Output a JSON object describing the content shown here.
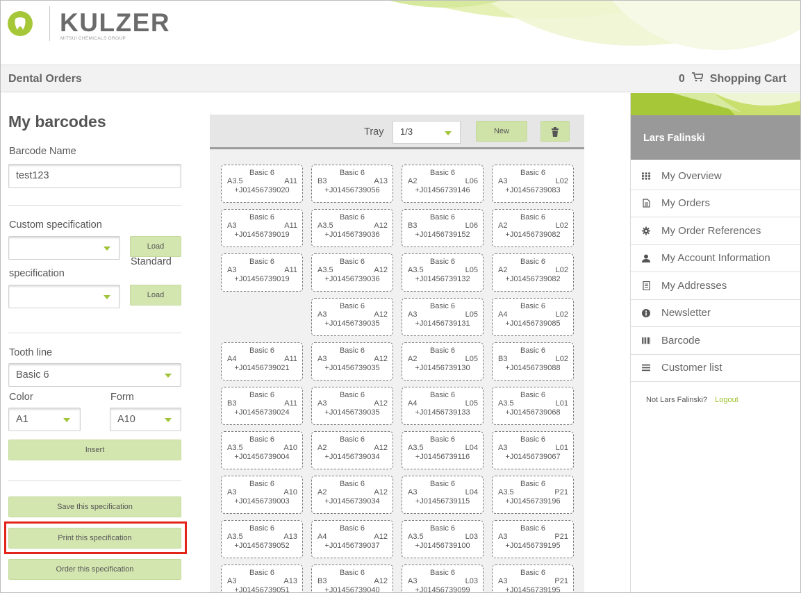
{
  "brand": {
    "name": "KULZER",
    "tagline": "MITSUI CHEMICALS GROUP"
  },
  "nav": {
    "title": "Dental Orders",
    "cart_count": "0",
    "cart_label": "Shopping Cart"
  },
  "form": {
    "heading": "My barcodes",
    "barcode_name_label": "Barcode Name",
    "barcode_name_value": "test123",
    "custom_spec_label": "Custom specification",
    "standard_label": "Standard",
    "spec_label": "specification",
    "load_label": "Load",
    "tooth_line_label": "Tooth line",
    "tooth_line_value": "Basic 6",
    "color_label": "Color",
    "color_value": "A1",
    "form_label": "Form",
    "form_value": "A10",
    "insert_label": "Insert",
    "save_label": "Save this specification",
    "print_label": "Print this specification",
    "order_label": "Order this specification"
  },
  "tray": {
    "label": "Tray",
    "value": "1/3",
    "new_label": "New"
  },
  "cards": [
    [
      {
        "line": "Basic 6",
        "color": "A3.5",
        "form": "A11",
        "code": "+J01456739020"
      },
      {
        "line": "Basic 6",
        "color": "B3",
        "form": "A13",
        "code": "+J01456739056"
      },
      {
        "line": "Basic 6",
        "color": "A2",
        "form": "L06",
        "code": "+J01456739146"
      },
      {
        "line": "Basic 6",
        "color": "A3",
        "form": "L02",
        "code": "+J01456739083"
      }
    ],
    [
      {
        "line": "Basic 6",
        "color": "A3",
        "form": "A11",
        "code": "+J01456739019"
      },
      {
        "line": "Basic 6",
        "color": "A3.5",
        "form": "A12",
        "code": "+J01456739036"
      },
      {
        "line": "Basic 6",
        "color": "B3",
        "form": "L06",
        "code": "+J01456739152"
      },
      {
        "line": "Basic 6",
        "color": "A2",
        "form": "L02",
        "code": "+J01456739082"
      }
    ],
    [
      {
        "line": "Basic 6",
        "color": "A3",
        "form": "A11",
        "code": "+J01456739019"
      },
      {
        "line": "Basic 6",
        "color": "A3.5",
        "form": "A12",
        "code": "+J01456739036"
      },
      {
        "line": "Basic 6",
        "color": "A3.5",
        "form": "L05",
        "code": "+J01456739132"
      },
      {
        "line": "Basic 6",
        "color": "A2",
        "form": "L02",
        "code": "+J01456739082"
      }
    ],
    [
      null,
      {
        "line": "Basic 6",
        "color": "A3",
        "form": "A12",
        "code": "+J01456739035"
      },
      {
        "line": "Basic 6",
        "color": "A3",
        "form": "L05",
        "code": "+J01456739131"
      },
      {
        "line": "Basic 6",
        "color": "A4",
        "form": "L02",
        "code": "+J01456739085"
      }
    ],
    [
      {
        "line": "Basic 6",
        "color": "A4",
        "form": "A11",
        "code": "+J01456739021"
      },
      {
        "line": "Basic 6",
        "color": "A3",
        "form": "A12",
        "code": "+J01456739035"
      },
      {
        "line": "Basic 6",
        "color": "A2",
        "form": "L05",
        "code": "+J01456739130"
      },
      {
        "line": "Basic 6",
        "color": "B3",
        "form": "L02",
        "code": "+J01456739088"
      }
    ],
    [
      {
        "line": "Basic 6",
        "color": "B3",
        "form": "A11",
        "code": "+J01456739024"
      },
      {
        "line": "Basic 6",
        "color": "A3",
        "form": "A12",
        "code": "+J01456739035"
      },
      {
        "line": "Basic 6",
        "color": "A4",
        "form": "L05",
        "code": "+J01456739133"
      },
      {
        "line": "Basic 6",
        "color": "A3.5",
        "form": "L01",
        "code": "+J01456739068"
      }
    ],
    [
      {
        "line": "Basic 6",
        "color": "A3.5",
        "form": "A10",
        "code": "+J01456739004"
      },
      {
        "line": "Basic 6",
        "color": "A2",
        "form": "A12",
        "code": "+J01456739034"
      },
      {
        "line": "Basic 6",
        "color": "A3.5",
        "form": "L04",
        "code": "+J01456739116"
      },
      {
        "line": "Basic 6",
        "color": "A3",
        "form": "L01",
        "code": "+J01456739067"
      }
    ],
    [
      {
        "line": "Basic 6",
        "color": "A3",
        "form": "A10",
        "code": "+J01456739003"
      },
      {
        "line": "Basic 6",
        "color": "A2",
        "form": "A12",
        "code": "+J01456739034"
      },
      {
        "line": "Basic 6",
        "color": "A3",
        "form": "L04",
        "code": "+J01456739115"
      },
      {
        "line": "Basic 6",
        "color": "A3.5",
        "form": "P21",
        "code": "+J01456739196"
      }
    ],
    [
      {
        "line": "Basic 6",
        "color": "A3.5",
        "form": "A13",
        "code": "+J01456739052"
      },
      {
        "line": "Basic 6",
        "color": "A4",
        "form": "A12",
        "code": "+J01456739037"
      },
      {
        "line": "Basic 6",
        "color": "A3.5",
        "form": "L03",
        "code": "+J01456739100"
      },
      {
        "line": "Basic 6",
        "color": "A3",
        "form": "P21",
        "code": "+J01456739195"
      }
    ],
    [
      {
        "line": "Basic 6",
        "color": "A3",
        "form": "A13",
        "code": "+J01456739051"
      },
      {
        "line": "Basic 6",
        "color": "B3",
        "form": "A12",
        "code": "+J01456739040"
      },
      {
        "line": "Basic 6",
        "color": "A3",
        "form": "L03",
        "code": "+J01456739099"
      },
      {
        "line": "Basic 6",
        "color": "A3",
        "form": "P21",
        "code": "+J01456739195"
      }
    ]
  ],
  "sidebar": {
    "user_name": "Lars Falinski",
    "items": [
      {
        "label": "My Overview",
        "icon": "grid-icon"
      },
      {
        "label": "My Orders",
        "icon": "document-icon"
      },
      {
        "label": "My Order References",
        "icon": "gear-icon"
      },
      {
        "label": "My Account Information",
        "icon": "user-icon"
      },
      {
        "label": "My Addresses",
        "icon": "address-book-icon"
      },
      {
        "label": "Newsletter",
        "icon": "info-icon"
      },
      {
        "label": "Barcode",
        "icon": "barcode-icon"
      },
      {
        "label": "Customer list",
        "icon": "list-icon"
      }
    ],
    "not_user_text": "Not Lars Falinski?",
    "logout_label": "Logout"
  },
  "colors": {
    "accent": "#a6c838",
    "button": "#d4e6b0",
    "highlight": "#e2241a",
    "user_bar": "#999999"
  }
}
